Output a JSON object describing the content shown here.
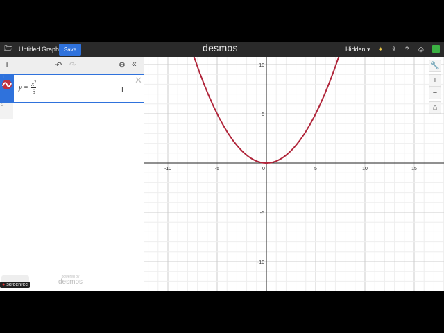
{
  "header": {
    "title": "Untitled Graph",
    "save_label": "Save",
    "logo": "desmos",
    "visibility": "Hidden"
  },
  "expressions": [
    {
      "index": "1",
      "latex_lhs": "y =",
      "numerator": "x",
      "exponent": "2",
      "denominator": "5",
      "color": "#c0313f"
    },
    {
      "index": "2"
    }
  ],
  "footer": {
    "powered_by": "powered by",
    "powered_logo": "desmos",
    "screenrec": "screenrec"
  },
  "graph": {
    "x_labels": [
      "-10",
      "-5",
      "0",
      "5",
      "10",
      "15"
    ],
    "y_labels": [
      "10",
      "5",
      "-5",
      "-10"
    ],
    "curve_color": "#b0253a",
    "function": "y=x^2/5"
  },
  "colors": {
    "accent": "#2f72dc"
  }
}
